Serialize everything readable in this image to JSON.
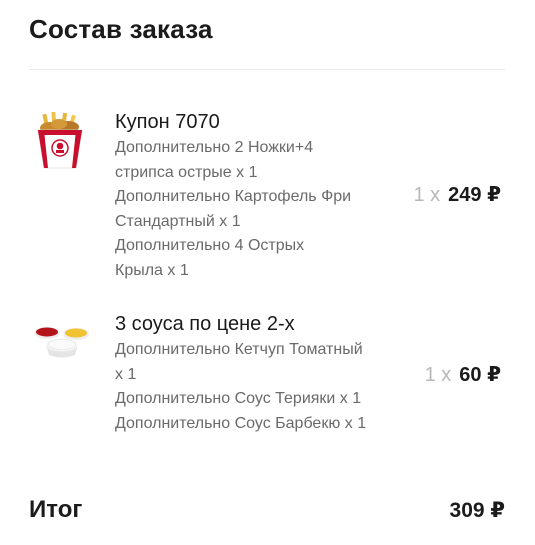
{
  "header": {
    "title": "Состав заказа"
  },
  "items": [
    {
      "name": "Купон 7070",
      "addons": [
        "Дополнительно 2 Ножки+4",
        "стрипса острые x 1",
        "Дополнительно Картофель Фри",
        "Стандартный x 1",
        "Дополнительно 4 Острых",
        "Крыла x 1"
      ],
      "quantity": "1 x",
      "price": "249 ₽"
    },
    {
      "name": "3 соуса по цене 2-х",
      "addons": [
        "Дополнительно Кетчуп Томатный",
        "x 1",
        "Дополнительно Соус Терияки x 1",
        "Дополнительно Соус Барбекю x 1"
      ],
      "quantity": "1 x",
      "price": "60 ₽"
    }
  ],
  "summary": {
    "total_label": "Итог",
    "total_value": "309 ₽"
  },
  "colors": {
    "text": "#1b1b1b",
    "secondary": "#6a6a6a",
    "qty": "#b8b8b8",
    "brand_red": "#c8102e"
  },
  "icons": [
    "chicken-bucket-image",
    "sauce-cups-image"
  ]
}
